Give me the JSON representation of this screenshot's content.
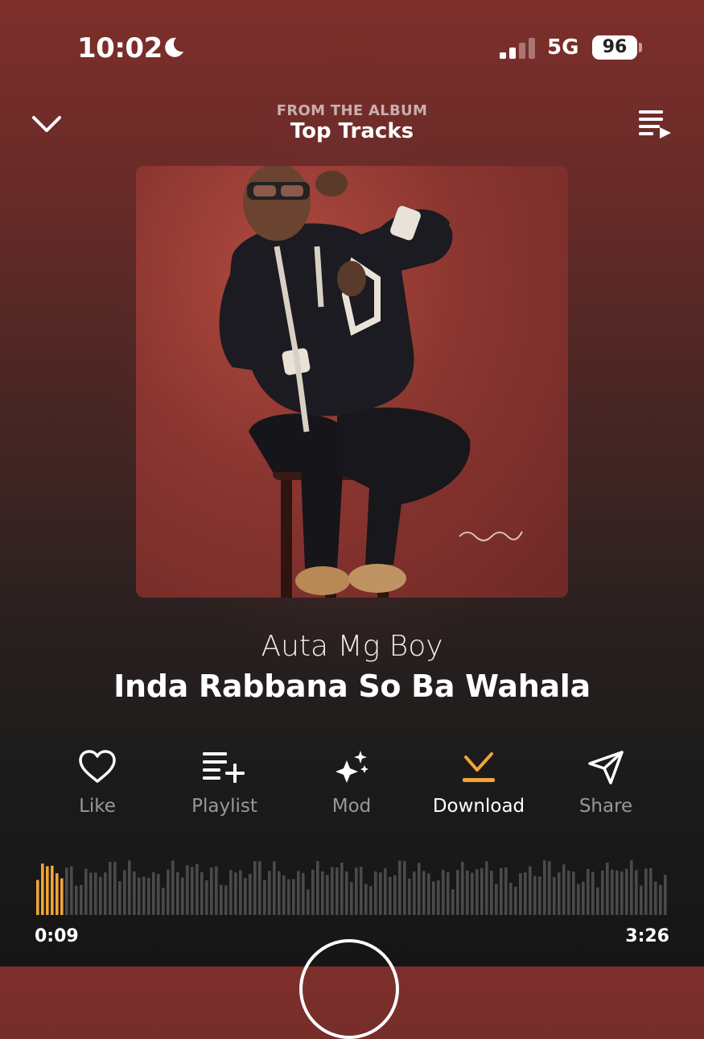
{
  "status_bar": {
    "time": "10:02",
    "network": "5G",
    "battery": "96"
  },
  "header": {
    "caption": "FROM THE ALBUM",
    "title": "Top Tracks"
  },
  "track": {
    "artist": "Auta Mg Boy",
    "title": "Inda Rabbana So Ba Wahala"
  },
  "actions": [
    {
      "label": "Like",
      "icon": "heart-icon",
      "active": false
    },
    {
      "label": "Playlist",
      "icon": "playlist-add-icon",
      "active": false
    },
    {
      "label": "Mod",
      "icon": "sparkle-icon",
      "active": false
    },
    {
      "label": "Download",
      "icon": "download-icon",
      "active": true
    },
    {
      "label": "Share",
      "icon": "share-icon",
      "active": false
    }
  ],
  "playback": {
    "elapsed": "0:09",
    "total": "3:26",
    "progress": 0.044
  },
  "colors": {
    "accent": "#f0a43a",
    "inactive_label": "#9a9a9a"
  }
}
